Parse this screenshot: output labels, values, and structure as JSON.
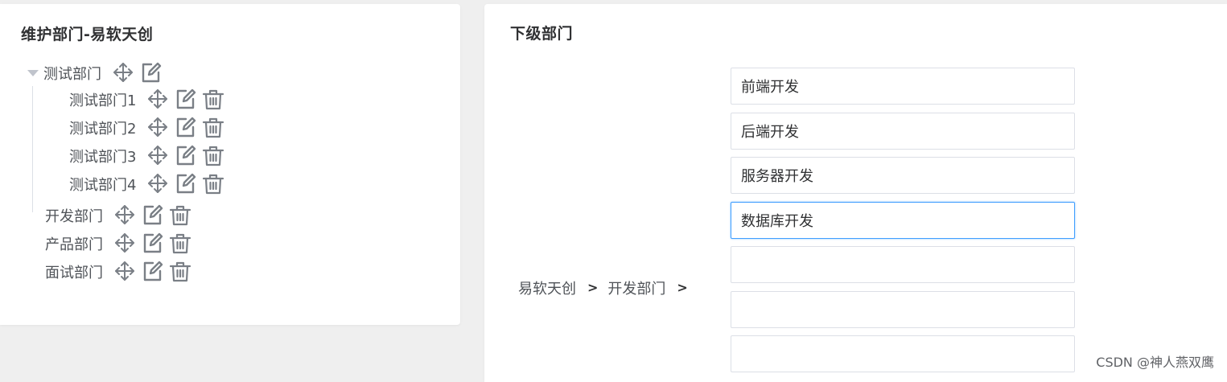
{
  "left_panel": {
    "title": "维护部门-易软天创",
    "tree": {
      "root": "测试部门",
      "children": [
        "测试部门1",
        "测试部门2",
        "测试部门3",
        "测试部门4"
      ],
      "siblings": [
        "开发部门",
        "产品部门",
        "面试部门"
      ]
    },
    "icons": {
      "move": "move-icon",
      "edit": "edit-icon",
      "delete": "delete-icon"
    }
  },
  "right_panel": {
    "title": "下级部门",
    "breadcrumb": {
      "level1": "易软天创",
      "level2": "开发部门"
    },
    "inputs": [
      "前端开发",
      "后端开发",
      "服务器开发",
      "数据库开发",
      "",
      "",
      ""
    ]
  },
  "watermark": "CSDN @神人燕双鹰",
  "colors": {
    "accent": "#409eff",
    "icon": "#7a7f86",
    "background": "#efefef"
  }
}
